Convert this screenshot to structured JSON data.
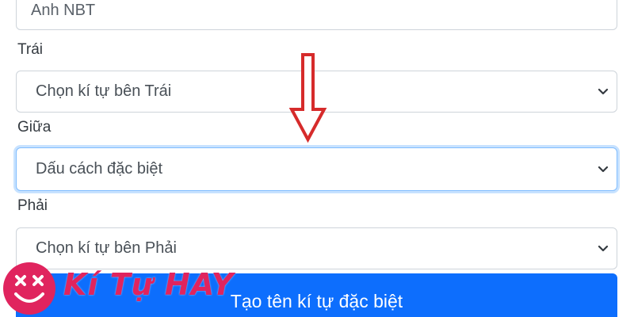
{
  "form": {
    "name_value": "Anh NBT",
    "left": {
      "label": "Trái",
      "selected": "Chọn kí tự bên Trái"
    },
    "middle": {
      "label": "Giữa",
      "selected": "Dấu cách đặc biệt"
    },
    "right": {
      "label": "Phải",
      "selected": "Chọn kí tự bên Phải"
    },
    "submit_label": "Tạo tên kí tự đặc biệt"
  },
  "annotation": {
    "icon": "down-arrow-icon",
    "color": "#d62b2b"
  },
  "watermark": {
    "text": "Kí Tự HAY",
    "icon": "smiley-face-icon",
    "color": "#e0245e"
  },
  "colors": {
    "primary_button": "#0d6efd",
    "focus_border": "#80bdff",
    "border": "#ced4da"
  }
}
